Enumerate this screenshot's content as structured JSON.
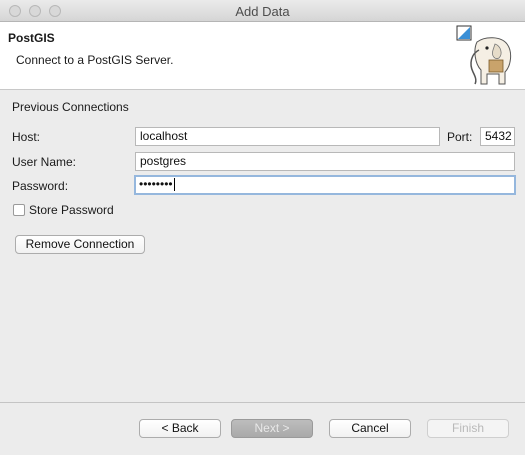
{
  "window": {
    "title": "Add Data"
  },
  "header": {
    "title": "PostGIS",
    "description": "Connect to a PostGIS Server.",
    "image_icon": "postgres-elephant-icon"
  },
  "form": {
    "previous_connections_label": "Previous Connections",
    "host_label": "Host:",
    "host_value": "localhost",
    "port_label": "Port:",
    "port_value": "5432",
    "username_label": "User Name:",
    "username_value": "postgres",
    "password_label": "Password:",
    "password_masked": "••••••••",
    "store_password_label": "Store Password",
    "store_password_checked": false,
    "remove_connection_label": "Remove Connection"
  },
  "footer": {
    "back_label": "< Back",
    "next_label": "Next >",
    "cancel_label": "Cancel",
    "finish_label": "Finish"
  }
}
